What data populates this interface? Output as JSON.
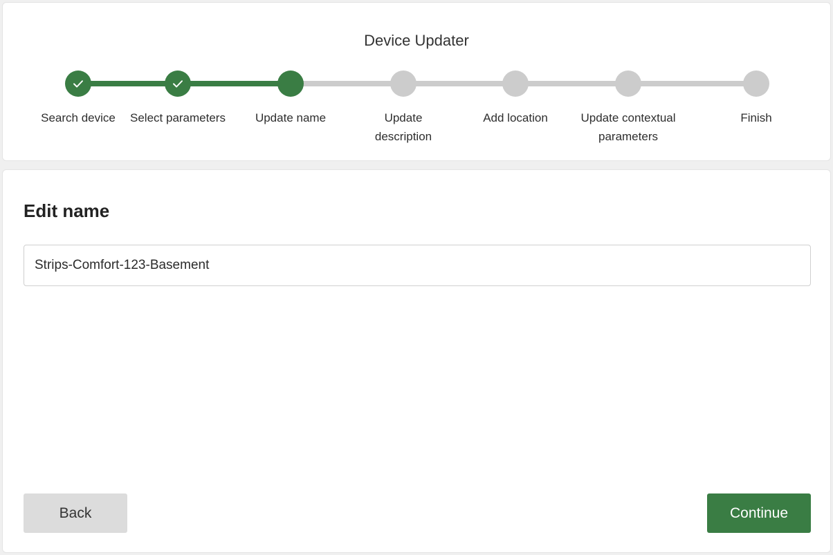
{
  "app": {
    "title": "Device Updater"
  },
  "stepper": {
    "steps": [
      {
        "label": "Search device",
        "state": "complete",
        "icon": "check-icon"
      },
      {
        "label": "Select parameters",
        "state": "complete",
        "icon": "check-icon"
      },
      {
        "label": "Update name",
        "state": "active",
        "icon": ""
      },
      {
        "label": "Update\ndescription",
        "state": "pending",
        "icon": ""
      },
      {
        "label": "Add location",
        "state": "pending",
        "icon": ""
      },
      {
        "label": "Update contextual\nparameters",
        "state": "pending",
        "icon": ""
      },
      {
        "label": "Finish",
        "state": "pending",
        "icon": ""
      }
    ]
  },
  "form": {
    "title": "Edit name",
    "name_value": "Strips-Comfort-123-Basement"
  },
  "buttons": {
    "back_label": "Back",
    "continue_label": "Continue"
  },
  "colors": {
    "accent": "#3a7d44",
    "pending": "#cccccc",
    "back_button": "#dcdcdc"
  }
}
